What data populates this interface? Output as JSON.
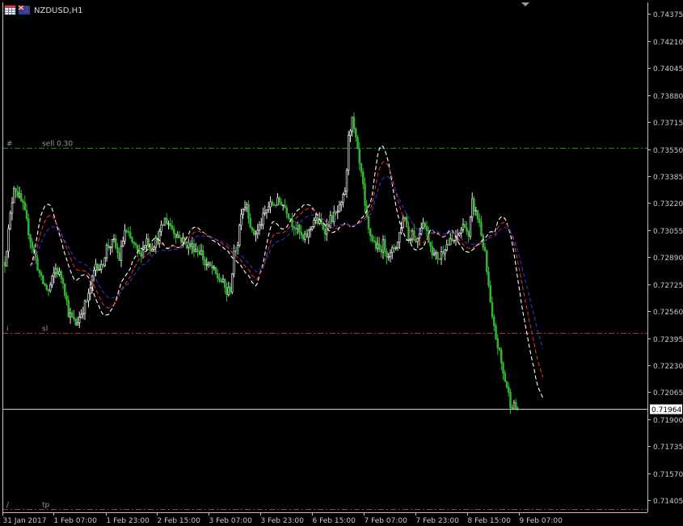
{
  "window": {
    "symbol_title": "NZDUSD,H1",
    "icons": [
      "chart-grid-icon",
      "flag-icon"
    ]
  },
  "chart_data": {
    "type": "candlestick",
    "symbol": "NZDUSD",
    "timeframe": "H1",
    "y_ticks": [
      "0.74375",
      "0.74210",
      "0.74045",
      "0.73880",
      "0.73715",
      "0.73550",
      "0.73385",
      "0.73220",
      "0.73055",
      "0.72890",
      "0.72725",
      "0.72560",
      "0.72395",
      "0.72230",
      "0.72065",
      "0.71900",
      "0.71735",
      "0.71570",
      "0.71405"
    ],
    "ylim": [
      0.71332,
      0.74446
    ],
    "x_ticks": [
      "31 Jan 2017",
      "1 Feb 07:00",
      "1 Feb 23:00",
      "2 Feb 15:00",
      "3 Feb 07:00",
      "3 Feb 23:00",
      "6 Feb 15:00",
      "7 Feb 07:00",
      "7 Feb 23:00",
      "8 Feb 15:00",
      "9 Feb 07:00"
    ],
    "current_price": "0.71964",
    "order_lines": [
      {
        "id": "sell",
        "marker": "#",
        "label": "sell 0.30",
        "price": 0.7356,
        "color": "#1e8c1e"
      },
      {
        "id": "sl",
        "marker": "i",
        "label": "sl",
        "price": 0.7243,
        "color": "#c03030"
      },
      {
        "id": "tp",
        "marker": "/",
        "label": "tp",
        "price": 0.7135,
        "color": "#c03030"
      }
    ],
    "colors": {
      "background": "#000000",
      "bull_candle": "#e6e6e6",
      "bear_candle": "#32b432",
      "ma_fast": "#ffffff",
      "ma_mid": "#dc3228",
      "ma_slow": "#3232c8",
      "axis": "#bfbfbf",
      "bid_line": "#c8c8c8"
    },
    "price_path": [
      [
        0,
        0.7286
      ],
      [
        5,
        0.7333
      ],
      [
        10,
        0.732
      ],
      [
        14,
        0.73
      ],
      [
        20,
        0.7275
      ],
      [
        24,
        0.7268
      ],
      [
        28,
        0.7282
      ],
      [
        32,
        0.7275
      ],
      [
        35,
        0.7255
      ],
      [
        39,
        0.7248
      ],
      [
        42,
        0.7255
      ],
      [
        46,
        0.7265
      ],
      [
        50,
        0.7285
      ],
      [
        53,
        0.7282
      ],
      [
        56,
        0.7295
      ],
      [
        60,
        0.7298
      ],
      [
        63,
        0.7288
      ],
      [
        66,
        0.7305
      ],
      [
        70,
        0.7298
      ],
      [
        74,
        0.729
      ],
      [
        78,
        0.73
      ],
      [
        80,
        0.7295
      ],
      [
        84,
        0.73
      ],
      [
        88,
        0.7312
      ],
      [
        90,
        0.731
      ],
      [
        93,
        0.7305
      ],
      [
        96,
        0.7301
      ],
      [
        100,
        0.7297
      ],
      [
        104,
        0.7295
      ],
      [
        108,
        0.7292
      ],
      [
        110,
        0.7285
      ],
      [
        114,
        0.7282
      ],
      [
        116,
        0.7278
      ],
      [
        120,
        0.7273
      ],
      [
        122,
        0.7267
      ],
      [
        124,
        0.727
      ],
      [
        126,
        0.729
      ],
      [
        128,
        0.7298
      ],
      [
        130,
        0.7318
      ],
      [
        133,
        0.7322
      ],
      [
        136,
        0.7303
      ],
      [
        139,
        0.7305
      ],
      [
        142,
        0.7313
      ],
      [
        145,
        0.732
      ],
      [
        148,
        0.7322
      ],
      [
        152,
        0.7323
      ],
      [
        155,
        0.7318
      ],
      [
        158,
        0.731
      ],
      [
        161,
        0.7306
      ],
      [
        164,
        0.7299
      ],
      [
        167,
        0.7304
      ],
      [
        170,
        0.7312
      ],
      [
        173,
        0.731
      ],
      [
        176,
        0.7306
      ],
      [
        179,
        0.7312
      ],
      [
        182,
        0.7315
      ],
      [
        185,
        0.732
      ],
      [
        187,
        0.733
      ],
      [
        188,
        0.734
      ],
      [
        189,
        0.7365
      ],
      [
        191,
        0.7372
      ],
      [
        193,
        0.736
      ],
      [
        195,
        0.7345
      ],
      [
        197,
        0.7332
      ],
      [
        198,
        0.7318
      ],
      [
        200,
        0.7305
      ],
      [
        202,
        0.73
      ],
      [
        204,
        0.7296
      ],
      [
        206,
        0.7293
      ],
      [
        208,
        0.7297
      ],
      [
        210,
        0.7292
      ],
      [
        212,
        0.729
      ],
      [
        214,
        0.7295
      ],
      [
        216,
        0.7298
      ],
      [
        218,
        0.7309
      ],
      [
        220,
        0.7315
      ],
      [
        222,
        0.73
      ],
      [
        224,
        0.7305
      ],
      [
        226,
        0.7298
      ],
      [
        228,
        0.7305
      ],
      [
        230,
        0.7312
      ],
      [
        233,
        0.73
      ],
      [
        236,
        0.729
      ],
      [
        239,
        0.7289
      ],
      [
        242,
        0.7296
      ],
      [
        245,
        0.7298
      ],
      [
        248,
        0.73
      ],
      [
        250,
        0.7304
      ],
      [
        253,
        0.731
      ],
      [
        255,
        0.73
      ],
      [
        257,
        0.7322
      ],
      [
        259,
        0.7316
      ],
      [
        261,
        0.731
      ],
      [
        264,
        0.729
      ],
      [
        266,
        0.727
      ],
      [
        268,
        0.725
      ],
      [
        270,
        0.724
      ],
      [
        272,
        0.723
      ],
      [
        274,
        0.7218
      ],
      [
        276,
        0.721
      ],
      [
        278,
        0.72
      ],
      [
        280,
        0.7198
      ],
      [
        282,
        0.7196
      ]
    ]
  }
}
